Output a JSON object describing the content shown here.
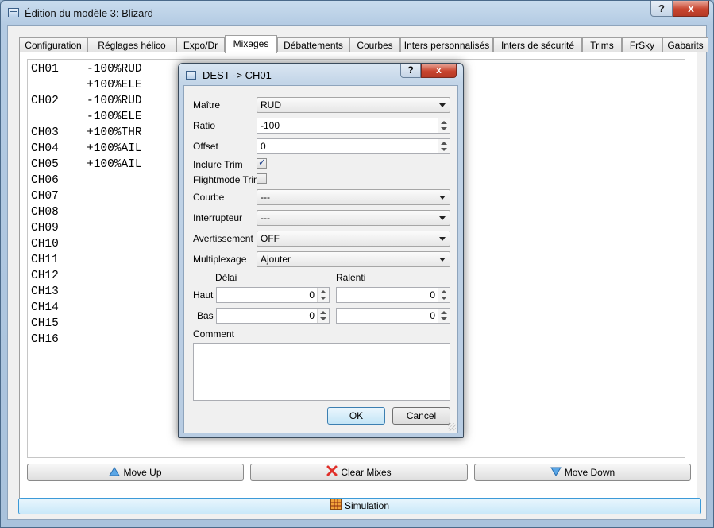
{
  "window": {
    "title": "Édition du modèle 3: Blizard",
    "help_label": "?",
    "close_label": "x"
  },
  "tabs": [
    {
      "label": "Configuration"
    },
    {
      "label": "Réglages hélico"
    },
    {
      "label": "Expo/Dr"
    },
    {
      "label": "Mixages"
    },
    {
      "label": "Débattements"
    },
    {
      "label": "Courbes"
    },
    {
      "label": "Inters personnalisés"
    },
    {
      "label": "Inters de sécurité"
    },
    {
      "label": "Trims"
    },
    {
      "label": "FrSky"
    },
    {
      "label": "Gabarits"
    }
  ],
  "active_tab": "Mixages",
  "mixes": [
    {
      "ch": "CH01",
      "val": "-100%RUD"
    },
    {
      "ch": "",
      "val": "+100%ELE"
    },
    {
      "ch": "CH02",
      "val": "-100%RUD"
    },
    {
      "ch": "",
      "val": "-100%ELE"
    },
    {
      "ch": "CH03",
      "val": "+100%THR"
    },
    {
      "ch": "CH04",
      "val": "+100%AIL"
    },
    {
      "ch": "CH05",
      "val": "+100%AIL"
    },
    {
      "ch": "CH06",
      "val": ""
    },
    {
      "ch": "CH07",
      "val": ""
    },
    {
      "ch": "CH08",
      "val": ""
    },
    {
      "ch": "CH09",
      "val": ""
    },
    {
      "ch": "CH10",
      "val": ""
    },
    {
      "ch": "CH11",
      "val": ""
    },
    {
      "ch": "CH12",
      "val": ""
    },
    {
      "ch": "CH13",
      "val": ""
    },
    {
      "ch": "CH14",
      "val": ""
    },
    {
      "ch": "CH15",
      "val": ""
    },
    {
      "ch": "CH16",
      "val": ""
    }
  ],
  "buttons": {
    "move_up": "Move Up",
    "clear_mixes": "Clear Mixes",
    "move_down": "Move Down",
    "simulation": "Simulation"
  },
  "dialog": {
    "title": "DEST -> CH01",
    "help_label": "?",
    "close_label": "x",
    "fields": {
      "maitre_label": "Maître",
      "maitre_value": "RUD",
      "ratio_label": "Ratio",
      "ratio_value": "-100",
      "offset_label": "Offset",
      "offset_value": "0",
      "inclure_trim_label": "Inclure Trim",
      "inclure_trim_checked": true,
      "flightmode_trim_label": "Flightmode Trim",
      "flightmode_trim_checked": false,
      "courbe_label": "Courbe",
      "courbe_value": "---",
      "interrupteur_label": "Interrupteur",
      "interrupteur_value": "---",
      "avertissement_label": "Avertissement",
      "avertissement_value": "OFF",
      "multiplexage_label": "Multiplexage",
      "multiplexage_value": "Ajouter",
      "delai_label": "Délai",
      "ralenti_label": "Ralenti",
      "haut_label": "Haut",
      "bas_label": "Bas",
      "delai_haut": "0",
      "ralenti_haut": "0",
      "delai_bas": "0",
      "ralenti_bas": "0",
      "comment_label": "Comment",
      "comment_value": ""
    },
    "ok_label": "OK",
    "cancel_label": "Cancel"
  },
  "colors": {
    "close_red": "#c8452f",
    "move_up_icon": "#5aa6e6",
    "clear_icon": "#e0302a",
    "sim_highlight": "#3c9ad8"
  }
}
